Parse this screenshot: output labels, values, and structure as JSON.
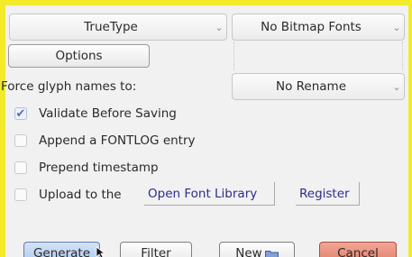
{
  "format_combo": {
    "value": "TrueType"
  },
  "bitmap_combo": {
    "value": "No Bitmap Fonts"
  },
  "options_button": {
    "label": "Options"
  },
  "glyph_names": {
    "label": "Force glyph names to:",
    "value": "No Rename"
  },
  "checkboxes": [
    {
      "label": "Validate Before Saving",
      "checked": true
    },
    {
      "label": "Append a FONTLOG entry",
      "checked": false
    },
    {
      "label": "Prepend timestamp",
      "checked": false
    },
    {
      "label": "Upload to the",
      "checked": false
    }
  ],
  "upload_links": {
    "open_font_library": "Open Font Library",
    "register": "Register"
  },
  "buttons": {
    "generate": "Generate",
    "filter": "Filter",
    "new": "New",
    "cancel": "Cancel"
  },
  "colors": {
    "frame": "#f2ea2a",
    "cancel_bg": "#e58a78",
    "generate_bg": "#bcd2f2",
    "check_accent": "#5a6db5"
  }
}
